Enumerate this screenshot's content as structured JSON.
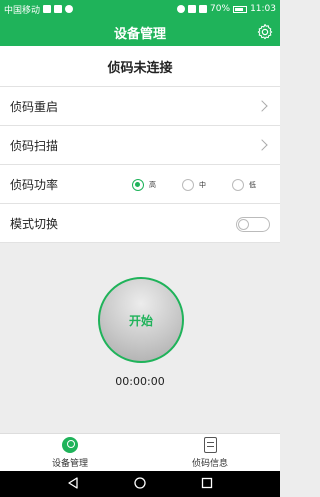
{
  "status_bar": {
    "carrier": "中国移动",
    "battery": "70%",
    "time": "11:03"
  },
  "title_bar": {
    "title": "设备管理",
    "settings_icon": "gear-icon"
  },
  "connection": {
    "status": "侦码未连接"
  },
  "menu": {
    "restart_label": "侦码重启",
    "scan_label": "侦码扫描",
    "power_label": "侦码功率",
    "mode_label": "模式切换"
  },
  "power_options": [
    {
      "label": "高",
      "checked": true
    },
    {
      "label": "中",
      "checked": false
    },
    {
      "label": "低",
      "checked": false
    }
  ],
  "mode_switch": {
    "on": false
  },
  "start_button": {
    "label": "开始"
  },
  "timer": {
    "value": "00:00:00"
  },
  "tabs": {
    "device": "设备管理",
    "info": "侦码信息"
  },
  "colors": {
    "accent": "#1fb35a",
    "background": "#ededed"
  }
}
